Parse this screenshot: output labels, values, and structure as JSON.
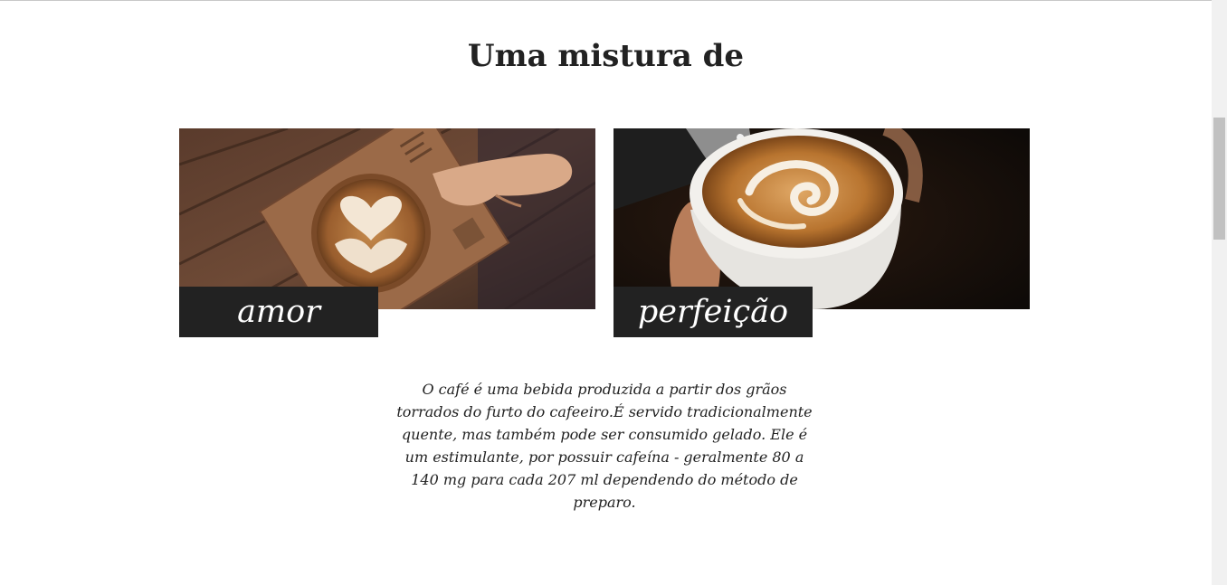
{
  "section": {
    "title": "Uma mistura de"
  },
  "cards": [
    {
      "caption": "amor",
      "image": "latte-art-heart-on-wooden-board"
    },
    {
      "caption": "perfeição",
      "image": "milk-pouring-into-cappuccino"
    }
  ],
  "description": "O café é uma bebida produzida a partir dos grãos torrados do furto do cafeeiro.É servido tradicionalmente quente, mas também pode ser consumido gelado. Ele é um estimulante, por possuir cafeína - geralmente 80 a 140 mg para cada 207 ml dependendo do método de preparo.",
  "colors": {
    "caption_background": "#222222",
    "caption_text": "#ffffff",
    "heading_text": "#222222"
  }
}
